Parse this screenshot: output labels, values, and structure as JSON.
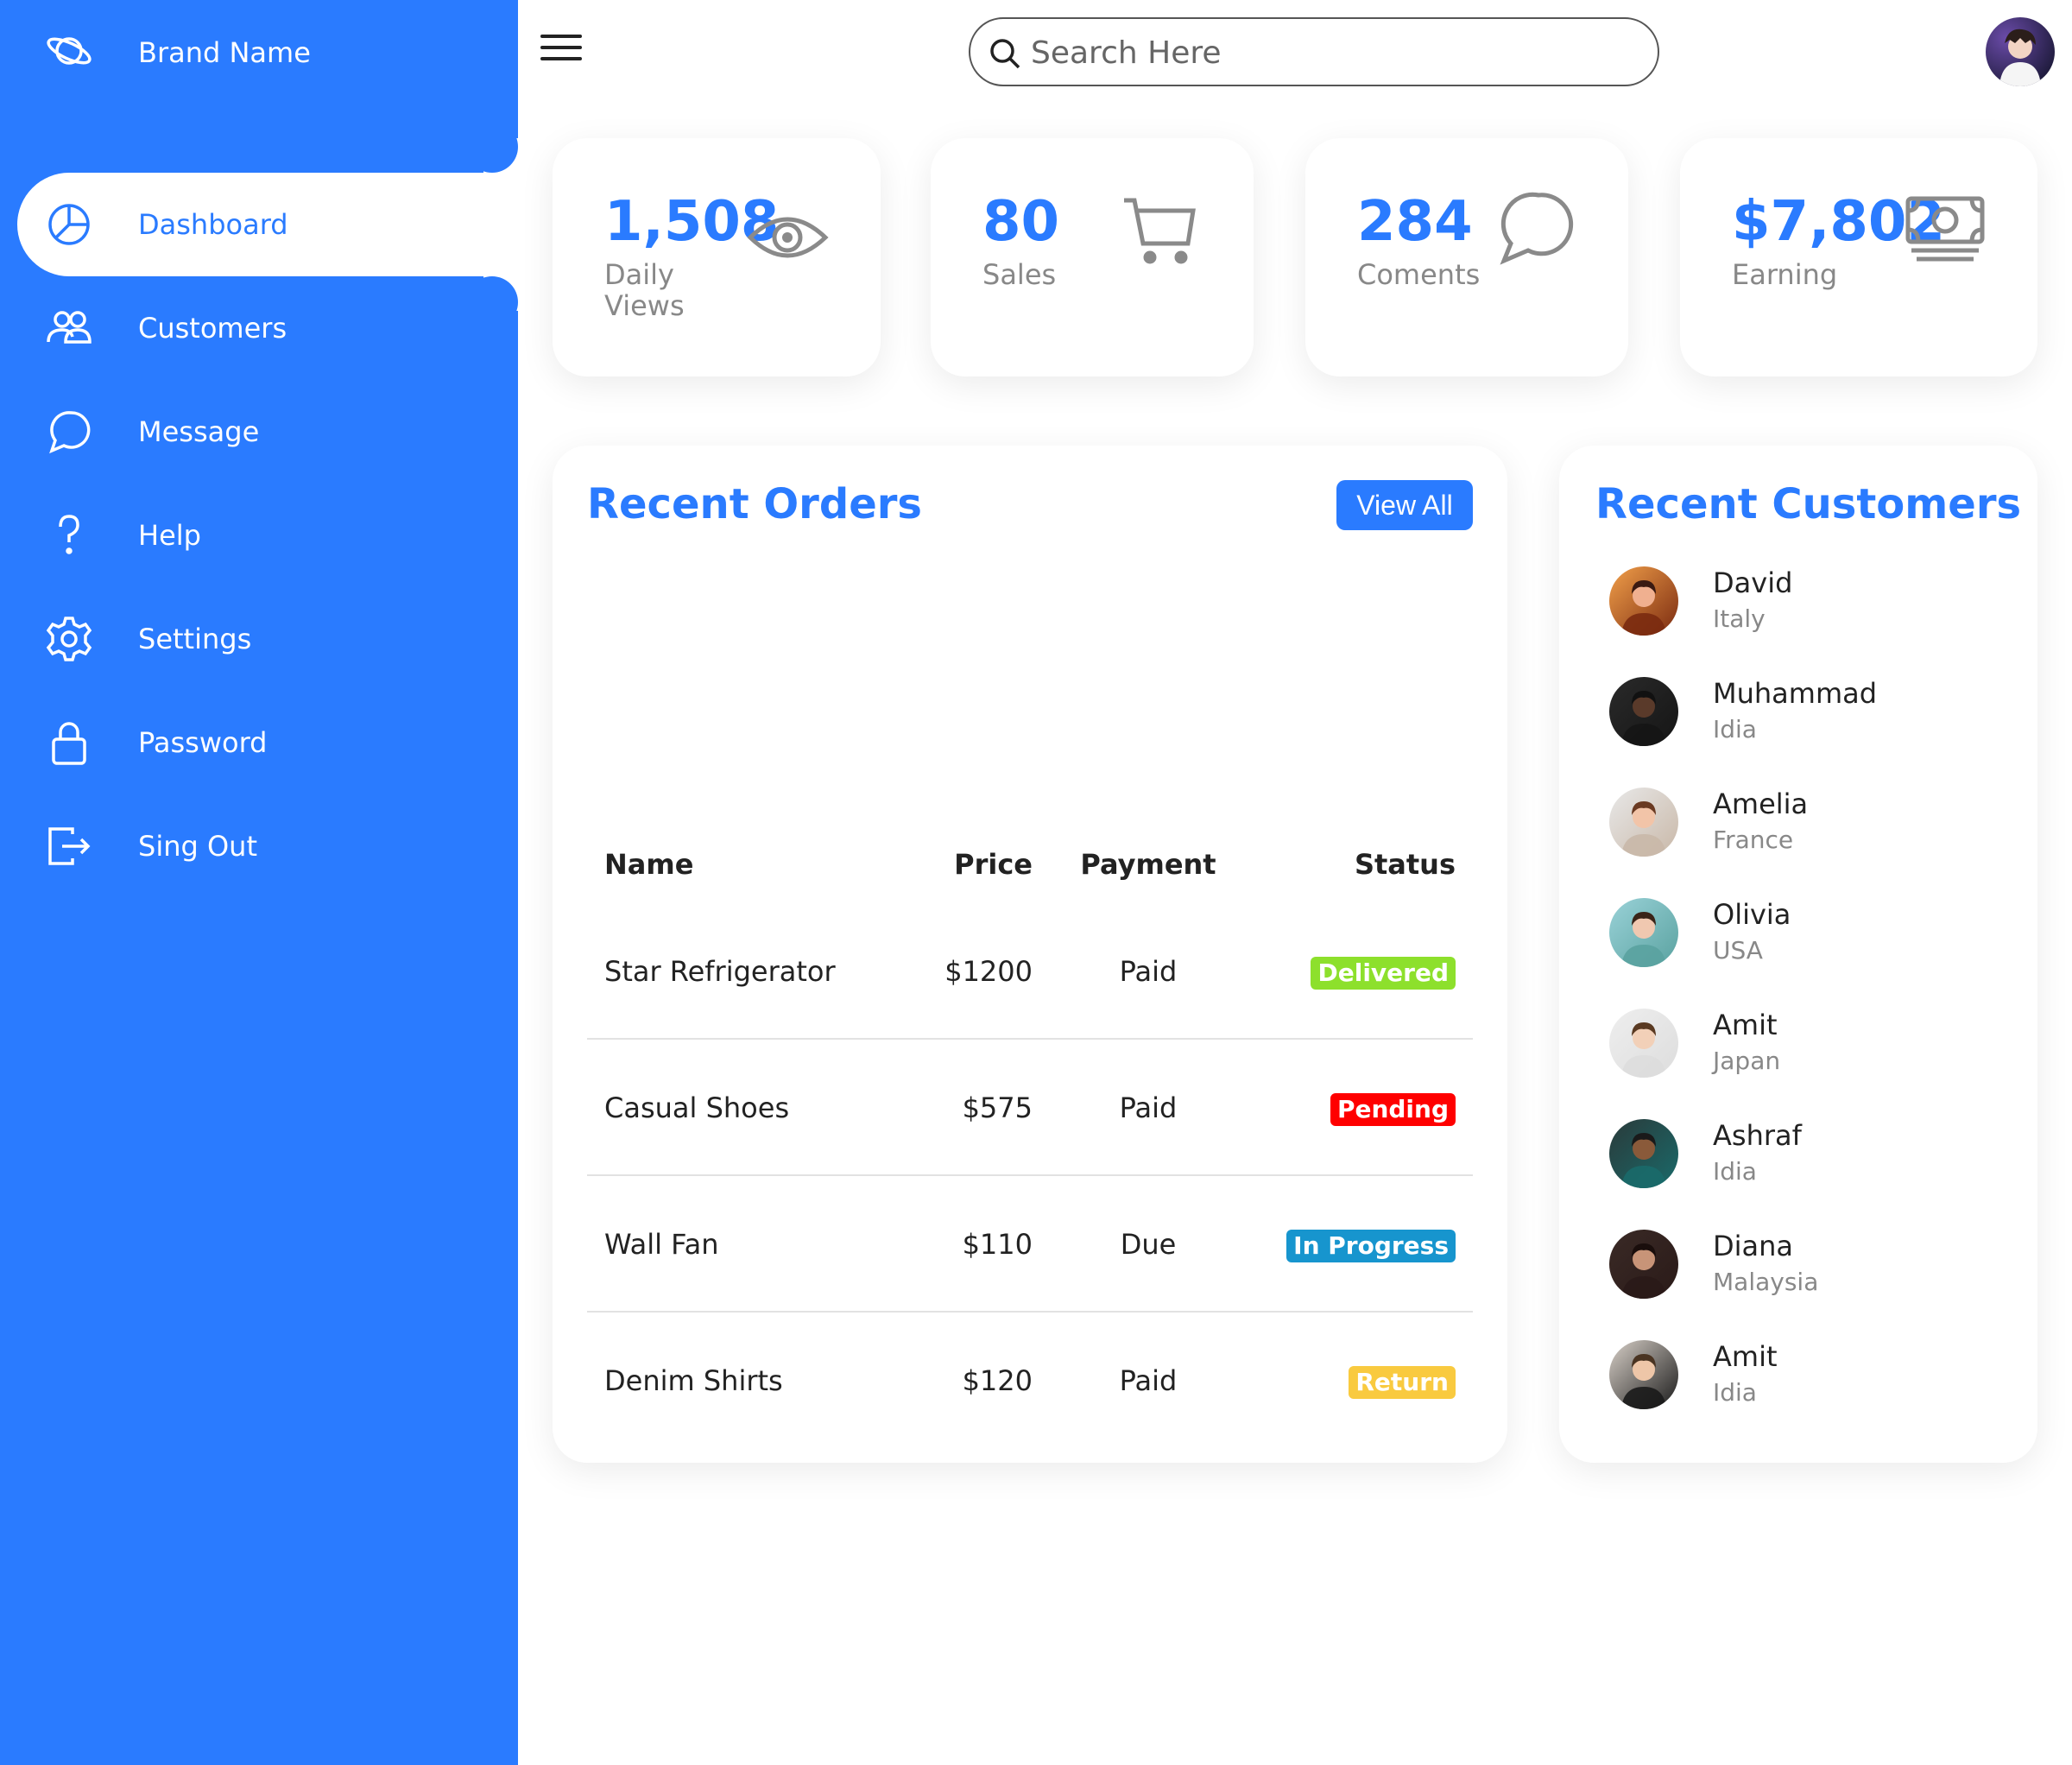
{
  "brand": {
    "name": "Brand Name",
    "icon": "planet-icon"
  },
  "nav": [
    {
      "label": "Dashboard",
      "icon": "pie-chart-icon",
      "active": true
    },
    {
      "label": "Customers",
      "icon": "people-icon"
    },
    {
      "label": "Message",
      "icon": "chat-bubble-icon"
    },
    {
      "label": "Help",
      "icon": "help-icon"
    },
    {
      "label": "Settings",
      "icon": "gear-icon"
    },
    {
      "label": "Password",
      "icon": "lock-icon"
    },
    {
      "label": "Sing Out",
      "icon": "logout-icon"
    }
  ],
  "search": {
    "placeholder": "Search Here"
  },
  "stats": [
    {
      "number": "1,508",
      "label": "Daily Views",
      "icon": "eye-icon"
    },
    {
      "number": "80",
      "label": "Sales",
      "icon": "cart-icon"
    },
    {
      "number": "284",
      "label": "Coments",
      "icon": "chat-bubble-icon"
    },
    {
      "number": "$7,802",
      "label": "Earning",
      "icon": "cash-icon"
    }
  ],
  "orders": {
    "title": "Recent Orders",
    "view_all_label": "View All",
    "headers": {
      "name": "Name",
      "price": "Price",
      "payment": "Payment",
      "status": "Status"
    },
    "rows": [
      {
        "name": "Star Refrigerator",
        "price": "$1200",
        "payment": "Paid",
        "status": "Delivered"
      },
      {
        "name": "Casual Shoes",
        "price": "$575",
        "payment": "Paid",
        "status": "Pending"
      },
      {
        "name": "Wall Fan",
        "price": "$110",
        "payment": "Due",
        "status": "In Progress"
      },
      {
        "name": "Denim Shirts",
        "price": "$120",
        "payment": "Paid",
        "status": "Return"
      }
    ]
  },
  "status_colors": {
    "Delivered": "#8de02c",
    "Pending": "#f00",
    "In Progress": "#1795ce",
    "Return": "#f9ca3f"
  },
  "customers": {
    "title": "Recent Customers",
    "list": [
      {
        "name": "David",
        "country": "Italy"
      },
      {
        "name": "Muhammad",
        "country": "Idia"
      },
      {
        "name": "Amelia",
        "country": "France"
      },
      {
        "name": "Olivia",
        "country": "USA"
      },
      {
        "name": "Amit",
        "country": "Japan"
      },
      {
        "name": "Ashraf",
        "country": "Idia"
      },
      {
        "name": "Diana",
        "country": "Malaysia"
      },
      {
        "name": "Amit",
        "country": "Idia"
      }
    ]
  },
  "colors": {
    "accent": "#2a7bff",
    "muted": "#888888"
  }
}
